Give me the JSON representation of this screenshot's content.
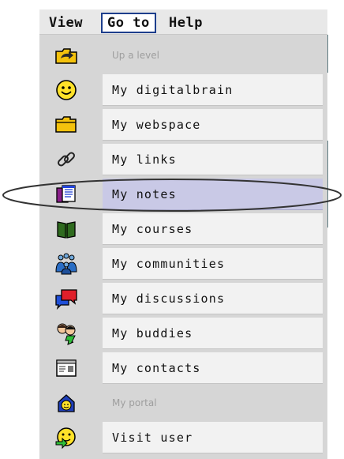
{
  "menubar": {
    "items": [
      "View",
      "Go to",
      "Help"
    ],
    "active": "Go to"
  },
  "goto_menu": {
    "items": [
      {
        "label": "Up a level",
        "icon": "up-level-folder-icon",
        "disabled": true
      },
      {
        "label": "My digitalbrain",
        "icon": "smiley-icon"
      },
      {
        "label": "My webspace",
        "icon": "folder-icon"
      },
      {
        "label": "My links",
        "icon": "chain-link-icon"
      },
      {
        "label": "My notes",
        "icon": "notes-icon",
        "selected": true
      },
      {
        "label": "My courses",
        "icon": "book-icon"
      },
      {
        "label": "My communities",
        "icon": "people-group-icon"
      },
      {
        "label": "My discussions",
        "icon": "speech-bubbles-icon"
      },
      {
        "label": "My buddies",
        "icon": "buddies-icon"
      },
      {
        "label": "My contacts",
        "icon": "contact-card-icon"
      },
      {
        "label": "My portal",
        "icon": "home-portal-icon",
        "disabled": true
      },
      {
        "label": "Visit user",
        "icon": "visit-user-icon"
      }
    ]
  },
  "colors": {
    "menu_bg": "#d6d6d6",
    "item_bg": "#f2f2f2",
    "selected_bg": "#c9c9e6",
    "active_border": "#1d3e8c",
    "highlight_ellipse": "#333333"
  }
}
